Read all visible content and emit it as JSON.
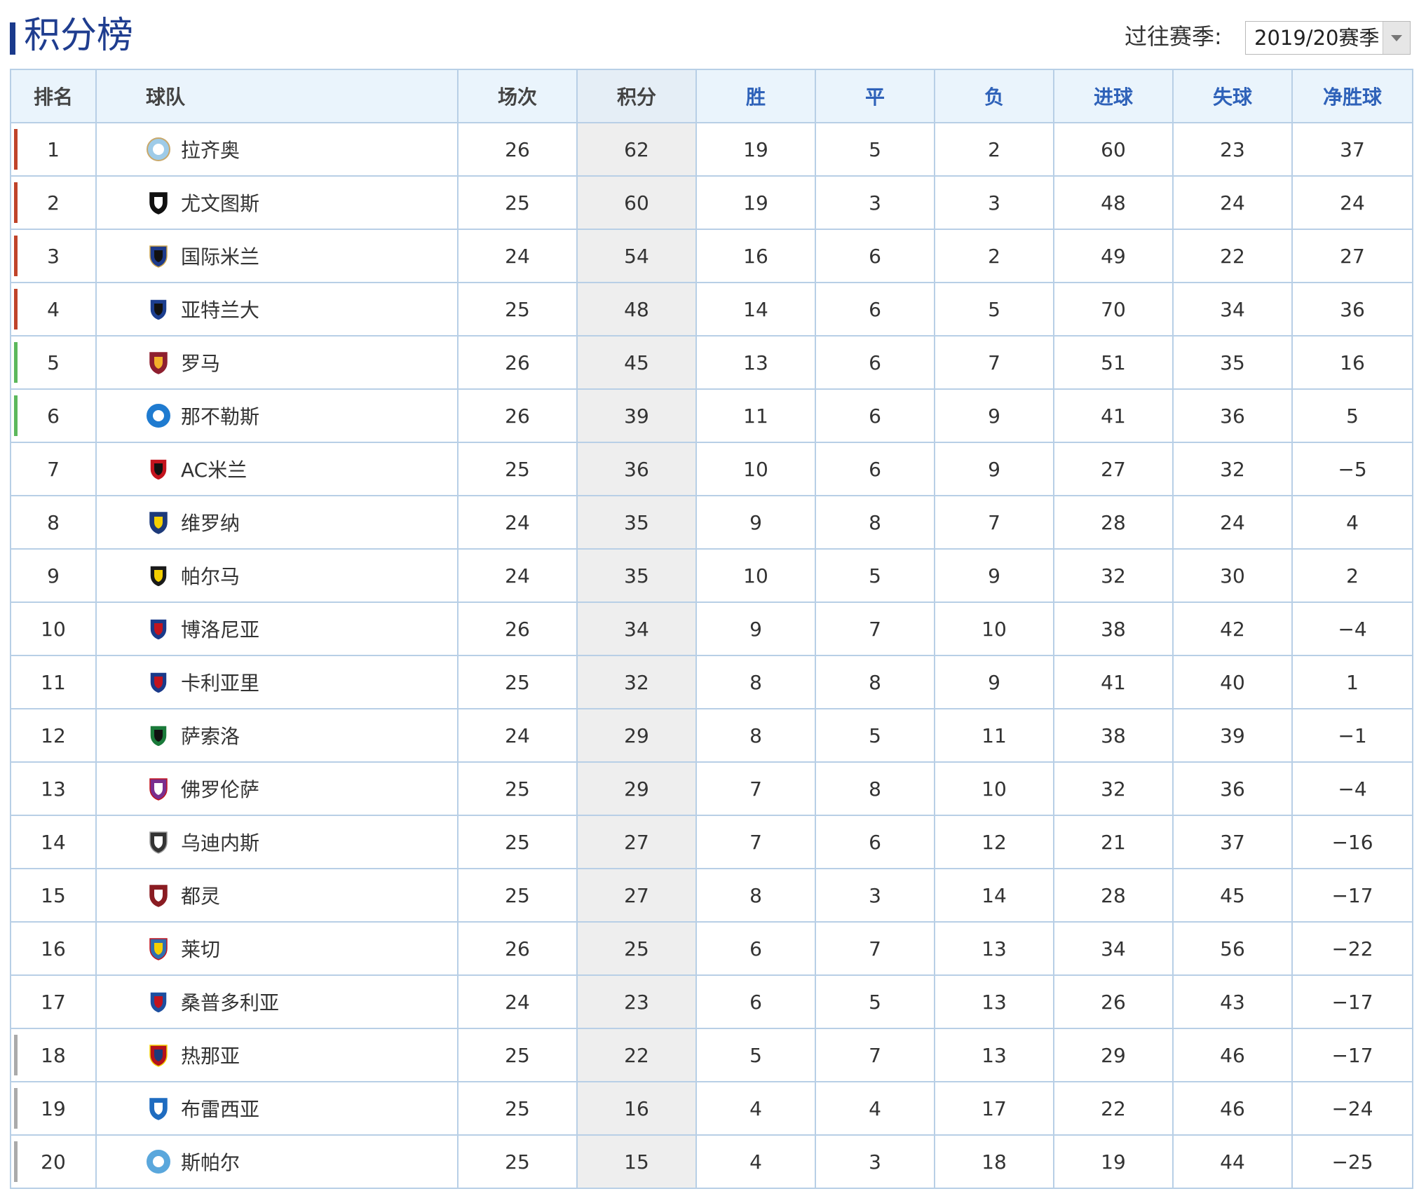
{
  "header": {
    "title": "积分榜",
    "season_label": "过往赛季:",
    "season_selected": "2019/20赛季"
  },
  "colors": {
    "title": "#1f3d8f",
    "border": "#b8cfe6",
    "header_bg": "#eaf4fc",
    "header_blue_text": "#2f62b9",
    "points_col_bg": "#eeeeee",
    "zone_champions": "#c0442a",
    "zone_europa": "#5cb85c",
    "zone_relegation": "#aaaaaa"
  },
  "table": {
    "columns": [
      "排名",
      "球队",
      "场次",
      "积分",
      "胜",
      "平",
      "负",
      "进球",
      "失球",
      "净胜球"
    ],
    "rows": [
      {
        "rank": "1",
        "team": "拉齐奥",
        "icon": "lazio-crest-icon",
        "played": "26",
        "points": "62",
        "won": "19",
        "drawn": "5",
        "lost": "2",
        "gf": "60",
        "ga": "23",
        "gd": "37",
        "zone": "champions"
      },
      {
        "rank": "2",
        "team": "尤文图斯",
        "icon": "juventus-crest-icon",
        "played": "25",
        "points": "60",
        "won": "19",
        "drawn": "3",
        "lost": "3",
        "gf": "48",
        "ga": "24",
        "gd": "24",
        "zone": "champions"
      },
      {
        "rank": "3",
        "team": "国际米兰",
        "icon": "inter-crest-icon",
        "played": "24",
        "points": "54",
        "won": "16",
        "drawn": "6",
        "lost": "2",
        "gf": "49",
        "ga": "22",
        "gd": "27",
        "zone": "champions"
      },
      {
        "rank": "4",
        "team": "亚特兰大",
        "icon": "atalanta-crest-icon",
        "played": "25",
        "points": "48",
        "won": "14",
        "drawn": "6",
        "lost": "5",
        "gf": "70",
        "ga": "34",
        "gd": "36",
        "zone": "champions"
      },
      {
        "rank": "5",
        "team": "罗马",
        "icon": "roma-crest-icon",
        "played": "26",
        "points": "45",
        "won": "13",
        "drawn": "6",
        "lost": "7",
        "gf": "51",
        "ga": "35",
        "gd": "16",
        "zone": "europa"
      },
      {
        "rank": "6",
        "team": "那不勒斯",
        "icon": "napoli-crest-icon",
        "played": "26",
        "points": "39",
        "won": "11",
        "drawn": "6",
        "lost": "9",
        "gf": "41",
        "ga": "36",
        "gd": "5",
        "zone": "europa"
      },
      {
        "rank": "7",
        "team": "AC米兰",
        "icon": "ac-milan-crest-icon",
        "played": "25",
        "points": "36",
        "won": "10",
        "drawn": "6",
        "lost": "9",
        "gf": "27",
        "ga": "32",
        "gd": "−5",
        "zone": "none"
      },
      {
        "rank": "8",
        "team": "维罗纳",
        "icon": "verona-crest-icon",
        "played": "24",
        "points": "35",
        "won": "9",
        "drawn": "8",
        "lost": "7",
        "gf": "28",
        "ga": "24",
        "gd": "4",
        "zone": "none"
      },
      {
        "rank": "9",
        "team": "帕尔马",
        "icon": "parma-crest-icon",
        "played": "24",
        "points": "35",
        "won": "10",
        "drawn": "5",
        "lost": "9",
        "gf": "32",
        "ga": "30",
        "gd": "2",
        "zone": "none"
      },
      {
        "rank": "10",
        "team": "博洛尼亚",
        "icon": "bologna-crest-icon",
        "played": "26",
        "points": "34",
        "won": "9",
        "drawn": "7",
        "lost": "10",
        "gf": "38",
        "ga": "42",
        "gd": "−4",
        "zone": "none"
      },
      {
        "rank": "11",
        "team": "卡利亚里",
        "icon": "cagliari-crest-icon",
        "played": "25",
        "points": "32",
        "won": "8",
        "drawn": "8",
        "lost": "9",
        "gf": "41",
        "ga": "40",
        "gd": "1",
        "zone": "none"
      },
      {
        "rank": "12",
        "team": "萨索洛",
        "icon": "sassuolo-crest-icon",
        "played": "24",
        "points": "29",
        "won": "8",
        "drawn": "5",
        "lost": "11",
        "gf": "38",
        "ga": "39",
        "gd": "−1",
        "zone": "none"
      },
      {
        "rank": "13",
        "team": "佛罗伦萨",
        "icon": "fiorentina-crest-icon",
        "played": "25",
        "points": "29",
        "won": "7",
        "drawn": "8",
        "lost": "10",
        "gf": "32",
        "ga": "36",
        "gd": "−4",
        "zone": "none"
      },
      {
        "rank": "14",
        "team": "乌迪内斯",
        "icon": "udinese-crest-icon",
        "played": "25",
        "points": "27",
        "won": "7",
        "drawn": "6",
        "lost": "12",
        "gf": "21",
        "ga": "37",
        "gd": "−16",
        "zone": "none"
      },
      {
        "rank": "15",
        "team": "都灵",
        "icon": "torino-crest-icon",
        "played": "25",
        "points": "27",
        "won": "8",
        "drawn": "3",
        "lost": "14",
        "gf": "28",
        "ga": "45",
        "gd": "−17",
        "zone": "none"
      },
      {
        "rank": "16",
        "team": "莱切",
        "icon": "lecce-crest-icon",
        "played": "26",
        "points": "25",
        "won": "6",
        "drawn": "7",
        "lost": "13",
        "gf": "34",
        "ga": "56",
        "gd": "−22",
        "zone": "none"
      },
      {
        "rank": "17",
        "team": "桑普多利亚",
        "icon": "sampdoria-crest-icon",
        "played": "24",
        "points": "23",
        "won": "6",
        "drawn": "5",
        "lost": "13",
        "gf": "26",
        "ga": "43",
        "gd": "−17",
        "zone": "none"
      },
      {
        "rank": "18",
        "team": "热那亚",
        "icon": "genoa-crest-icon",
        "played": "25",
        "points": "22",
        "won": "5",
        "drawn": "7",
        "lost": "13",
        "gf": "29",
        "ga": "46",
        "gd": "−17",
        "zone": "relegation"
      },
      {
        "rank": "19",
        "team": "布雷西亚",
        "icon": "brescia-crest-icon",
        "played": "25",
        "points": "16",
        "won": "4",
        "drawn": "4",
        "lost": "17",
        "gf": "22",
        "ga": "46",
        "gd": "−24",
        "zone": "relegation"
      },
      {
        "rank": "20",
        "team": "斯帕尔",
        "icon": "spal-crest-icon",
        "played": "25",
        "points": "15",
        "won": "4",
        "drawn": "3",
        "lost": "18",
        "gf": "19",
        "ga": "44",
        "gd": "−25",
        "zone": "relegation"
      }
    ]
  }
}
